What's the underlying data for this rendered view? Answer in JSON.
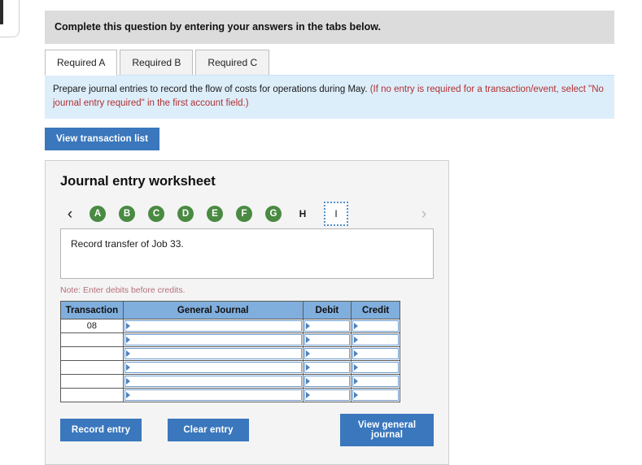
{
  "corner": {
    "name": "cut-off-window-edge"
  },
  "instruction": {
    "text": "Complete this question by entering your answers in the tabs below."
  },
  "tabs": [
    {
      "label": "Required A",
      "active": true
    },
    {
      "label": "Required B",
      "active": false
    },
    {
      "label": "Required C",
      "active": false
    }
  ],
  "prompt": {
    "black_text": "Prepare journal entries to record the flow of costs for operations during May. ",
    "red_text": "(If no entry is required for a transaction/event, select \"No journal entry required\" in the first account field.)"
  },
  "toolbar": {
    "view_transaction_list": "View transaction list"
  },
  "worksheet": {
    "title": "Journal entry worksheet",
    "prev_arrow": "‹",
    "next_arrow": "›",
    "pages": [
      {
        "label": "A",
        "state": "complete"
      },
      {
        "label": "B",
        "state": "complete"
      },
      {
        "label": "C",
        "state": "complete"
      },
      {
        "label": "D",
        "state": "complete"
      },
      {
        "label": "E",
        "state": "complete"
      },
      {
        "label": "F",
        "state": "complete"
      },
      {
        "label": "G",
        "state": "complete"
      },
      {
        "label": "H",
        "state": "plain"
      },
      {
        "label": "I",
        "state": "active"
      }
    ],
    "description": "Record transfer of Job 33.",
    "note": "Note: Enter debits before credits.",
    "table": {
      "headers": [
        "Transaction",
        "General Journal",
        "Debit",
        "Credit"
      ],
      "rows": [
        {
          "transaction": "08",
          "general_journal": "",
          "debit": "",
          "credit": ""
        },
        {
          "transaction": "",
          "general_journal": "",
          "debit": "",
          "credit": ""
        },
        {
          "transaction": "",
          "general_journal": "",
          "debit": "",
          "credit": ""
        },
        {
          "transaction": "",
          "general_journal": "",
          "debit": "",
          "credit": ""
        },
        {
          "transaction": "",
          "general_journal": "",
          "debit": "",
          "credit": ""
        },
        {
          "transaction": "",
          "general_journal": "",
          "debit": "",
          "credit": ""
        }
      ]
    },
    "actions": {
      "record_entry": "Record entry",
      "clear_entry": "Clear entry",
      "view_general_journal": "View general journal"
    }
  },
  "colors": {
    "button_blue": "#3a77bd",
    "table_header_blue": "#80aedd",
    "pager_green": "#4a8a42",
    "prompt_bg": "#ddeefb",
    "banner_gray": "#dcdcdc",
    "note_red": "#b5707a",
    "prompt_red": "#b03030"
  }
}
